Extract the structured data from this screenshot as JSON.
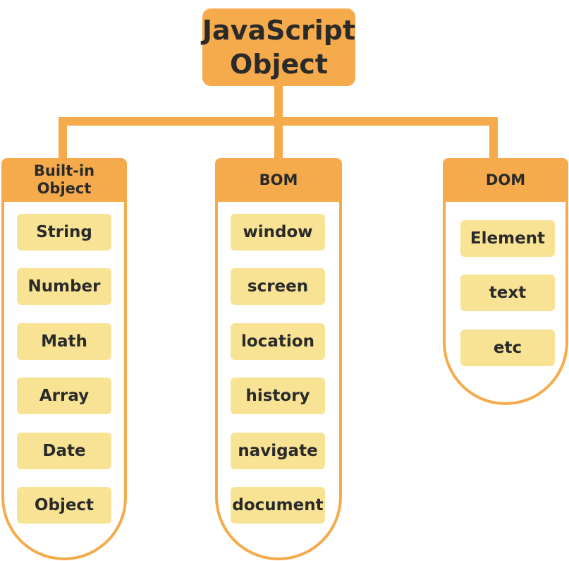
{
  "colors": {
    "accent": "#f5ab4c",
    "item_fill": "#f8e394",
    "text": "#2a2a2a"
  },
  "root": {
    "title": "JavaScript\nObject"
  },
  "columns": [
    {
      "header": "Built-in\nObject",
      "items": [
        "String",
        "Number",
        "Math",
        "Array",
        "Date",
        "Object"
      ]
    },
    {
      "header": "BOM",
      "items": [
        "window",
        "screen",
        "location",
        "history",
        "navigate",
        "document"
      ]
    },
    {
      "header": "DOM",
      "items": [
        "Element",
        "text",
        "etc"
      ]
    }
  ]
}
